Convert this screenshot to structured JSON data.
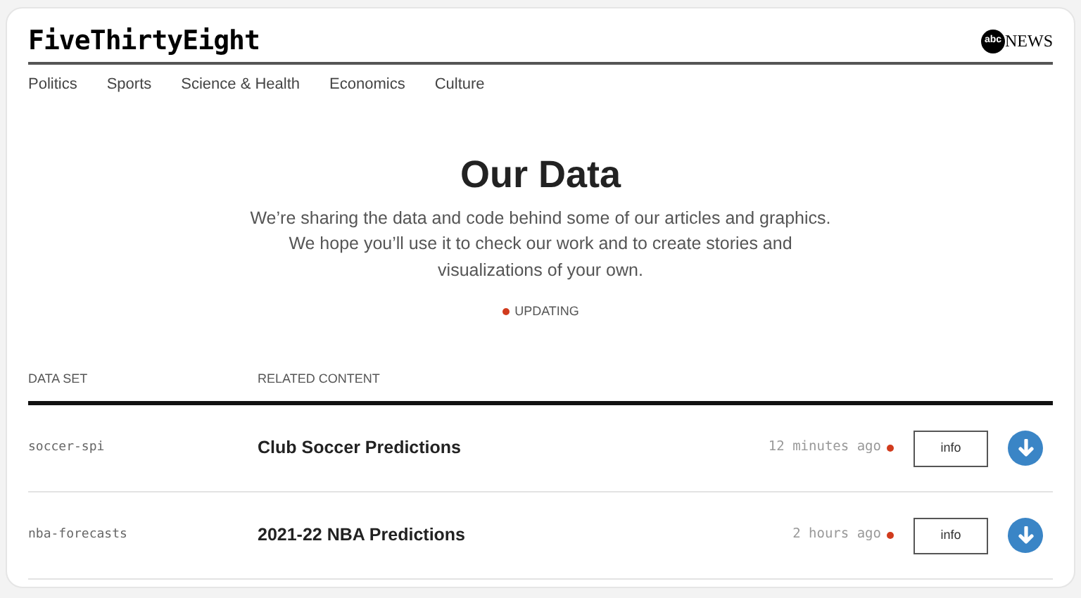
{
  "brand": {
    "logo": "FiveThirtyEight",
    "partner_mark": "abc",
    "partner_name": "NEWS"
  },
  "nav": [
    "Politics",
    "Sports",
    "Science & Health",
    "Economics",
    "Culture"
  ],
  "hero": {
    "title": "Our Data",
    "lines": [
      "We’re sharing the data and code behind some of our articles and graphics.",
      "We hope you’ll use it to check our work and to create stories and",
      "visualizations of your own."
    ],
    "legend": "UPDATING"
  },
  "table": {
    "columns": [
      "DATA SET",
      "RELATED CONTENT"
    ],
    "rows": [
      {
        "dataset": "soccer-spi",
        "content": "Club Soccer Predictions",
        "updated": "12 minutes ago",
        "updating": true,
        "info": "info"
      },
      {
        "dataset": "nba-forecasts",
        "content": "2021-22 NBA Predictions",
        "updated": "2 hours ago",
        "updating": true,
        "info": "info"
      }
    ]
  }
}
